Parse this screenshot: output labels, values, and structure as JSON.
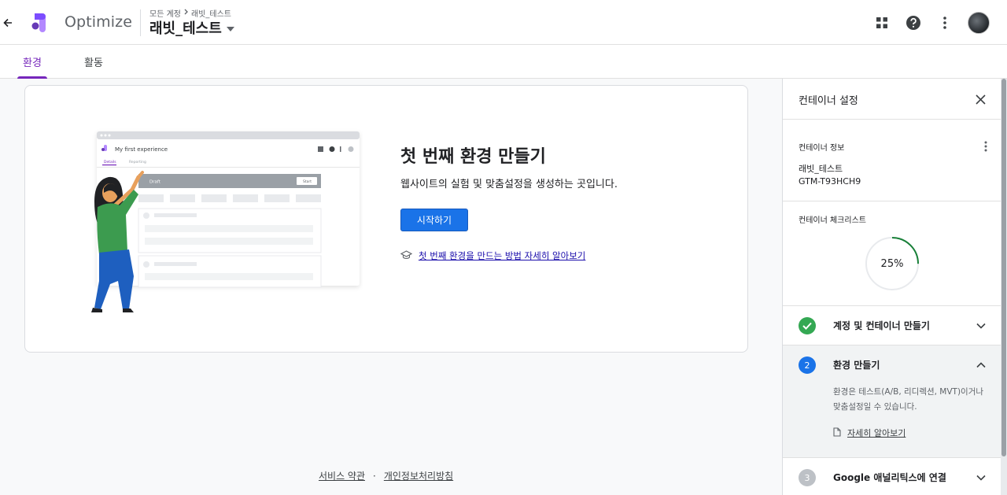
{
  "header": {
    "app_name": "Optimize",
    "breadcrumb_parent": "모든 계정",
    "breadcrumb_child": "래빗_테스트",
    "account_title": "래빗_테스트"
  },
  "tabs": [
    {
      "label": "환경",
      "active": true
    },
    {
      "label": "활동",
      "active": false
    }
  ],
  "main": {
    "title": "첫 번째 환경 만들기",
    "subtitle": "웹사이트의 실험 및 맞춤설정을 생성하는 곳입니다.",
    "start_button": "시작하기",
    "learn_link": "첫 번째 환경을 만드는 방법 자세히 알아보기",
    "illustration": {
      "window_title": "My first experience",
      "tab_details": "Details",
      "tab_reporting": "Reporting",
      "draft_label": "Draft",
      "start_label": "Start"
    }
  },
  "footer": {
    "terms": "서비스 약관",
    "separator": "·",
    "privacy": "개인정보처리방침"
  },
  "panel": {
    "title": "컨테이너 설정",
    "info_label": "컨테이너 정보",
    "container_name": "래빗_테스트",
    "container_id": "GTM-T93HCH9",
    "checklist_label": "컨테이너 체크리스트",
    "progress_text": "25%",
    "progress_value": 25,
    "steps": [
      {
        "number": "1",
        "title": "계정 및 컨테이너 만들기",
        "done": true
      },
      {
        "number": "2",
        "title": "환경 만들기",
        "done": false,
        "expanded": true,
        "description": "환경은 테스트(A/B, 리디렉션, MVT)이거나 맞춤설정일 수 있습니다.",
        "link": "자세히 알아보기"
      },
      {
        "number": "3",
        "title": "Google 애널리틱스에 연결",
        "done": false
      }
    ]
  },
  "colors": {
    "accent": "#7627bb",
    "primary_button": "#1a73e8",
    "done_green": "#34a853",
    "active_blue": "#1a73e8",
    "pending_gray": "#bdc1c6"
  }
}
